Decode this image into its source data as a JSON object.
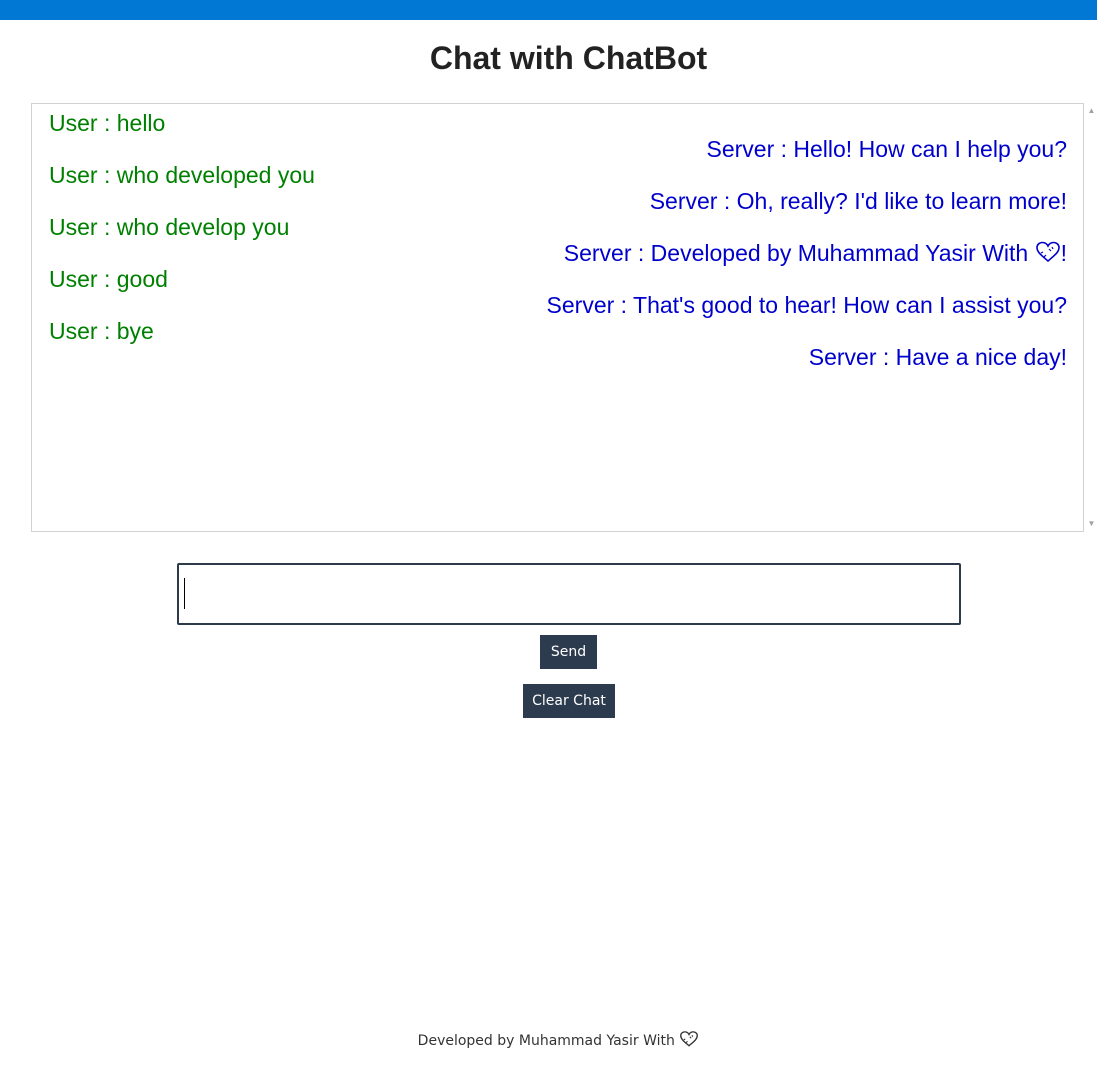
{
  "header": {
    "title": "Chat with ChatBot",
    "bar_color": "#0078d4"
  },
  "chat": {
    "user_color": "#008000",
    "server_color": "#0000cc",
    "messages": [
      {
        "sender": "user",
        "text": "User : hello"
      },
      {
        "sender": "server",
        "text": "Server : Hello! How can I help you?"
      },
      {
        "sender": "user",
        "text": "User : who developed you"
      },
      {
        "sender": "server",
        "text": "Server : Oh, really? I'd like to learn more!"
      },
      {
        "sender": "user",
        "text": "User : who develop you"
      },
      {
        "sender": "server",
        "text": "Server : Developed by Muhammad Yasir With",
        "suffix": "!",
        "icon": "heart-icon"
      },
      {
        "sender": "user",
        "text": "User : good"
      },
      {
        "sender": "server",
        "text": "Server : That's good to hear! How can I assist you?"
      },
      {
        "sender": "user",
        "text": "User : bye"
      },
      {
        "sender": "server",
        "text": "Server : Have a nice day!"
      }
    ]
  },
  "input": {
    "value": "",
    "placeholder": ""
  },
  "buttons": {
    "send_label": "Send",
    "clear_label": "Clear Chat",
    "color": "#2d3b4e"
  },
  "footer": {
    "text": "Developed by Muhammad Yasir With",
    "icon": "heart-icon"
  }
}
